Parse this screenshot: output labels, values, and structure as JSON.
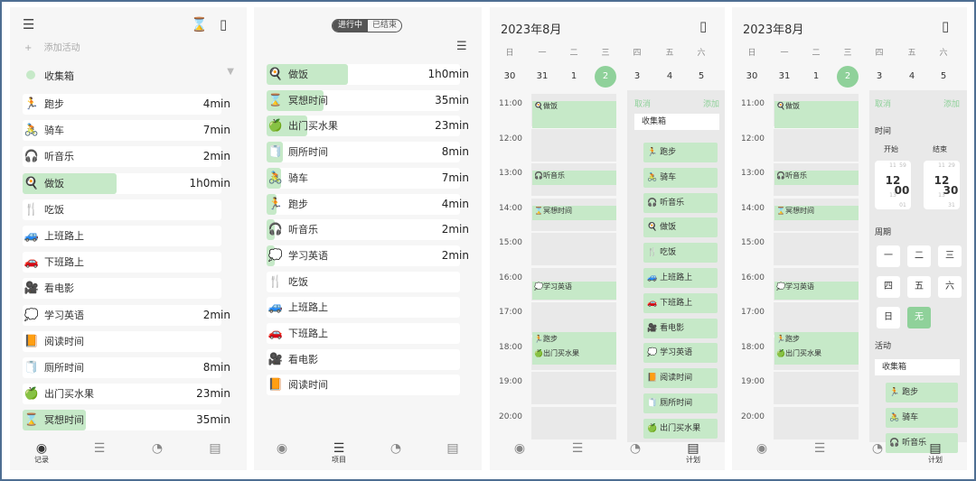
{
  "panel1": {
    "add_label": "添加活动",
    "inbox_label": "收集箱",
    "rows": [
      {
        "icon": "🏃",
        "name": "跑步",
        "dur": "4min",
        "fill": 0
      },
      {
        "icon": "🚴",
        "name": "骑车",
        "dur": "7min",
        "fill": 0
      },
      {
        "icon": "🎧",
        "name": "听音乐",
        "dur": "2min",
        "fill": 0
      },
      {
        "icon": "🍳",
        "name": "做饭",
        "dur": "1h0min",
        "fill": 0.45
      },
      {
        "icon": "🍴",
        "name": "吃饭",
        "dur": "",
        "fill": 0
      },
      {
        "icon": "🚙",
        "name": "上班路上",
        "dur": "",
        "fill": 0
      },
      {
        "icon": "🚗",
        "name": "下班路上",
        "dur": "",
        "fill": 0
      },
      {
        "icon": "🎥",
        "name": "看电影",
        "dur": "",
        "fill": 0
      },
      {
        "icon": "💭",
        "name": "学习英语",
        "dur": "2min",
        "fill": 0
      },
      {
        "icon": "📙",
        "name": "阅读时间",
        "dur": "",
        "fill": 0
      },
      {
        "icon": "🧻",
        "name": "厕所时间",
        "dur": "8min",
        "fill": 0
      },
      {
        "icon": "🍏",
        "name": "出门买水果",
        "dur": "23min",
        "fill": 0
      },
      {
        "icon": "⌛",
        "name": "冥想时间",
        "dur": "35min",
        "fill": 0.3
      }
    ],
    "nav": {
      "record": "记录"
    }
  },
  "panel2": {
    "seg_active": "进行中",
    "seg_done": "已结束",
    "rows": [
      {
        "icon": "🍳",
        "name": "做饭",
        "dur": "1h0min",
        "fill": 0.4
      },
      {
        "icon": "⌛",
        "name": "冥想时间",
        "dur": "35min",
        "fill": 0.28
      },
      {
        "icon": "🍏",
        "name": "出门买水果",
        "dur": "23min",
        "fill": 0.2
      },
      {
        "icon": "🧻",
        "name": "厕所时间",
        "dur": "8min",
        "fill": 0.08
      },
      {
        "icon": "🚴",
        "name": "骑车",
        "dur": "7min",
        "fill": 0.07
      },
      {
        "icon": "🏃",
        "name": "跑步",
        "dur": "4min",
        "fill": 0.05
      },
      {
        "icon": "🎧",
        "name": "听音乐",
        "dur": "2min",
        "fill": 0.04
      },
      {
        "icon": "💭",
        "name": "学习英语",
        "dur": "2min",
        "fill": 0.04
      },
      {
        "icon": "🍴",
        "name": "吃饭",
        "dur": "",
        "fill": 0
      },
      {
        "icon": "🚙",
        "name": "上班路上",
        "dur": "",
        "fill": 0
      },
      {
        "icon": "🚗",
        "name": "下班路上",
        "dur": "",
        "fill": 0
      },
      {
        "icon": "🎥",
        "name": "看电影",
        "dur": "",
        "fill": 0
      },
      {
        "icon": "📙",
        "name": "阅读时间",
        "dur": "",
        "fill": 0
      }
    ],
    "nav": {
      "items": "项目"
    }
  },
  "calendar": {
    "title": "2023年8月",
    "weekdays": [
      "日",
      "一",
      "二",
      "三",
      "四",
      "五",
      "六"
    ],
    "dates": [
      "30",
      "31",
      "1",
      "2",
      "3",
      "4",
      "5"
    ],
    "selected_index": 3,
    "times": [
      "11:00",
      "12:00",
      "13:00",
      "14:00",
      "15:00",
      "16:00",
      "17:00",
      "18:00",
      "19:00",
      "20:00"
    ],
    "events": [
      {
        "label": "🍳做饭"
      },
      {
        "label": "🎧听音乐"
      },
      {
        "label": "⌛冥想时间"
      },
      {
        "label": "💭学习英语"
      },
      {
        "label": "🏃跑步"
      },
      {
        "label": "🍏出门买水果"
      }
    ],
    "nav_plan": "计划"
  },
  "panel3": {
    "cancel": "取消",
    "add": "添加",
    "inbox": "收集箱",
    "list": [
      "🏃 跑步",
      "🚴 骑车",
      "🎧 听音乐",
      "🍳 做饭",
      "🍴 吃饭",
      "🚙 上班路上",
      "🚗 下班路上",
      "🎥 看电影",
      "💭 学习英语",
      "📙 阅读时间",
      "🧻 厕所时间",
      "🍏 出门买水果"
    ]
  },
  "panel4": {
    "cancel": "取消",
    "add": "添加",
    "time_label": "时间",
    "start_label": "开始",
    "end_label": "结束",
    "start": {
      "h_prev": "11",
      "h": "12",
      "h_next": "13",
      "m_prev": "59",
      "m": "00",
      "m_next": "01"
    },
    "end": {
      "h_prev": "11",
      "h": "12",
      "h_next": "13",
      "m_prev": "29",
      "m": "30",
      "m_next": "31"
    },
    "week_label": "周期",
    "week_btns": [
      "一",
      "二",
      "三",
      "四",
      "五",
      "六",
      "日",
      "无"
    ],
    "activity_label": "活动",
    "inbox": "收集箱",
    "list": [
      "🏃 跑步",
      "🚴 骑车",
      "🎧 听音乐"
    ]
  }
}
